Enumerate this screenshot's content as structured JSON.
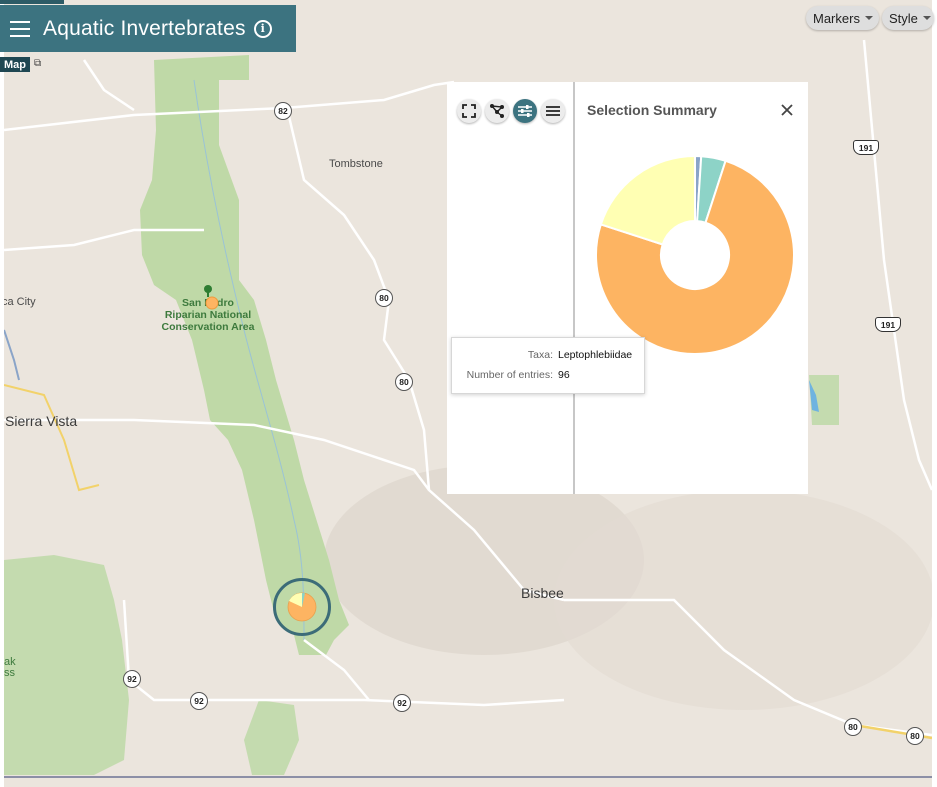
{
  "app": {
    "title": "Aquatic Invertebrates",
    "info_icon": "info-icon",
    "menu_icon": "hamburger-menu-icon",
    "map_tag": "Map",
    "colors": {
      "accent": "#3c7380",
      "dark_accent": "#1f4752"
    }
  },
  "toolbar_top_right": {
    "markers_label": "Markers",
    "style_label": "Style"
  },
  "map": {
    "places": {
      "tombstone": "Tombstone",
      "sierra_vista": "Sierra Vista",
      "bisbee": "Bisbee",
      "huachuca": "ca City",
      "ramsey_1": "ak",
      "ramsey_2": "ss",
      "park_1": "San Pedro",
      "park_2": "Riparian National",
      "park_3": "Conservation Area"
    },
    "routes": {
      "r82": "82",
      "r80a": "80",
      "r80b": "80",
      "r80c": "80",
      "r80d": "80",
      "r92a": "92",
      "r92b": "92",
      "r92c": "92",
      "us191a": "191",
      "us191b": "191"
    }
  },
  "panel": {
    "title": "Selection Summary",
    "tools": [
      "fullscreen-icon",
      "polygon-select-icon",
      "filter-sliders-icon",
      "list-icon"
    ],
    "close_icon": "close-icon"
  },
  "tooltip": {
    "taxa_label": "Taxa:",
    "taxa_value": "Leptophlebiidae",
    "entries_label": "Number of entries:",
    "entries_value": "96"
  },
  "chart_data": {
    "type": "pie",
    "donut": true,
    "title": "",
    "slices": [
      {
        "value": 1,
        "color": "#8aa4c8"
      },
      {
        "value": 4,
        "color": "#8dd3c7"
      },
      {
        "value": 75,
        "color": "#fdb462"
      },
      {
        "value": 20,
        "color": "#ffffb3"
      }
    ]
  }
}
